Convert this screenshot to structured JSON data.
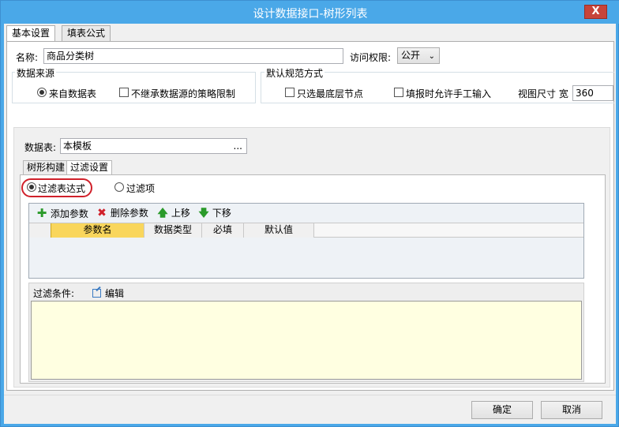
{
  "window": {
    "title": "设计数据接口-树形列表",
    "close_label": "X"
  },
  "tabs": [
    {
      "label": "基本设置",
      "active": true
    },
    {
      "label": "填表公式",
      "active": false
    }
  ],
  "basic": {
    "name_label": "名称:",
    "name_value": "商品分类树",
    "access_label": "访问权限:",
    "access_value": "公开"
  },
  "data_source": {
    "group_title": "数据来源",
    "from_table_label": "来自数据表",
    "from_table_checked": true,
    "no_inherit_label": "不继承数据源的策略限制",
    "no_inherit_checked": false
  },
  "default_spec": {
    "group_title": "默认规范方式",
    "leaf_only_label": "只选最底层节点",
    "leaf_only_checked": false,
    "allow_manual_label": "填报时允许手工输入",
    "allow_manual_checked": false,
    "view_size_label": "视图尺寸 宽",
    "view_size_value": "360"
  },
  "datatable": {
    "label": "数据表:",
    "value": "本模板",
    "browse_label": "..."
  },
  "subtabs": [
    {
      "label": "树形构建",
      "active": false
    },
    {
      "label": "过滤设置",
      "active": true
    }
  ],
  "filter_mode": {
    "expression_label": "过滤表达式",
    "expression_checked": true,
    "item_label": "过滤项",
    "item_checked": false
  },
  "toolbar": {
    "add_label": "添加参数",
    "delete_label": "删除参数",
    "up_label": "上移",
    "down_label": "下移",
    "icons": [
      "plus-icon",
      "delete-x-icon",
      "arrow-up-icon",
      "arrow-down-icon"
    ]
  },
  "grid": {
    "columns": [
      "参数名",
      "数据类型",
      "必填",
      "默认值"
    ]
  },
  "filter_condition": {
    "label": "过滤条件:",
    "edit_label": "编辑",
    "value": ""
  },
  "footer": {
    "ok_label": "确定",
    "cancel_label": "取消"
  },
  "colors": {
    "titlebar": "#4aa8e8",
    "close": "#c7443a",
    "selected_column": "#f9d65c",
    "filter_area": "#ffffe1",
    "highlight_ring": "#d0202a"
  }
}
